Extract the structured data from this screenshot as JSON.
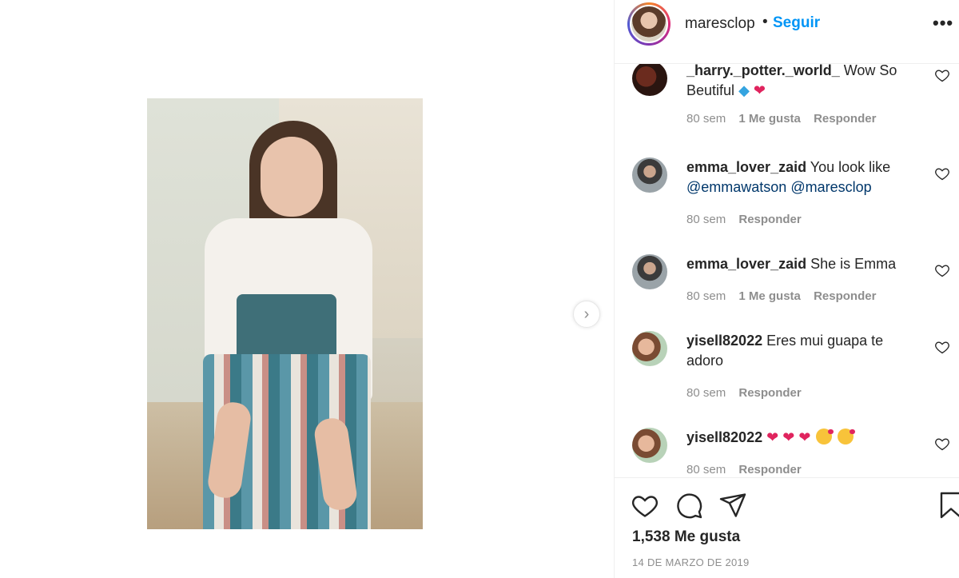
{
  "post": {
    "username": "maresclop",
    "separator": "•",
    "follow_label": "Seguir",
    "more_label": "•••",
    "next_label": "›"
  },
  "comments": [
    {
      "user": "_harry._potter._world_",
      "text": "Wow So Beutiful",
      "emojis_after": [
        "gem-emoji",
        "red-heart-emoji"
      ],
      "time": "80 sem",
      "likes": "1 Me gusta",
      "reply": "Responder"
    },
    {
      "user": "emma_lover_zaid",
      "text": "You look like",
      "mention1": "@emmawatson",
      "mention2": "@maresclop",
      "time": "80 sem",
      "reply": "Responder"
    },
    {
      "user": "emma_lover_zaid",
      "text": "She is Emma",
      "time": "80 sem",
      "likes": "1 Me gusta",
      "reply": "Responder"
    },
    {
      "user": "yisell82022",
      "text": "Eres mui guapa te adoro",
      "time": "80 sem",
      "reply": "Responder"
    },
    {
      "user": "yisell82022",
      "text": "",
      "emojis_after": [
        "red-heart-emoji",
        "red-heart-emoji",
        "red-heart-emoji",
        "kiss-face-emoji",
        "kiss-face-emoji"
      ],
      "time": "80 sem",
      "reply": "Responder"
    }
  ],
  "footer": {
    "likes": "1,538 Me gusta",
    "date": "14 DE MARZO DE 2019"
  },
  "colors": {
    "accent": "#0095f6",
    "text": "#262626",
    "muted": "#8e8e8e",
    "heart": "#e0245e"
  }
}
